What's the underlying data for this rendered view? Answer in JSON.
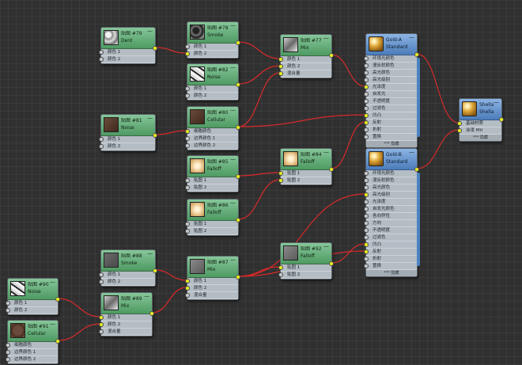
{
  "editor": {
    "accent": "#5aa870",
    "wire_color": "#d82a2a",
    "port_color": "#e8f020"
  },
  "nodes": [
    {
      "id": "n79",
      "kind": "map",
      "icon": "dent-texture-icon",
      "title": "贴图 #79",
      "subtitle": "Dent",
      "rows": [
        "颜色 1",
        "颜色 2"
      ],
      "connected": [
        false,
        false
      ],
      "out": true
    },
    {
      "id": "n78",
      "kind": "map",
      "icon": "smoke-texture-icon",
      "title": "贴图 #78",
      "subtitle": "Smoke",
      "rows": [
        "颜色 1",
        "颜色 2"
      ],
      "connected": [
        false,
        true
      ],
      "out": true
    },
    {
      "id": "n82",
      "kind": "map",
      "icon": "noise-texture-icon",
      "title": "贴图 #82",
      "subtitle": "Noise",
      "rows": [
        "颜色 1",
        "颜色 2"
      ],
      "connected": [
        false,
        false
      ],
      "out": true
    },
    {
      "id": "n81",
      "kind": "map",
      "icon": "noise-texture-icon",
      "title": "贴图 #81",
      "subtitle": "Noise",
      "rows": [
        "颜色 1",
        "颜色 2"
      ],
      "connected": [
        false,
        false
      ],
      "out": true
    },
    {
      "id": "n80",
      "kind": "map",
      "icon": "cellular-texture-icon",
      "title": "贴图 #80",
      "subtitle": "Cellular",
      "rows": [
        "细胞颜色",
        "边界颜色 1",
        "边界颜色 2"
      ],
      "connected": [
        true,
        false,
        false
      ],
      "out": true
    },
    {
      "id": "n77",
      "kind": "map",
      "icon": "mix-texture-icon",
      "title": "贴图 #77",
      "subtitle": "Mix",
      "rows": [
        "颜色 1",
        "颜色 2",
        "混合量"
      ],
      "connected": [
        true,
        true,
        true
      ],
      "out": true
    },
    {
      "id": "n85",
      "kind": "map",
      "icon": "falloff-texture-icon",
      "title": "贴图 #85",
      "subtitle": "Falloff",
      "rows": [
        "贴图 1",
        "贴图 2"
      ],
      "connected": [
        false,
        false
      ],
      "out": true
    },
    {
      "id": "n84",
      "kind": "map",
      "icon": "falloff-texture-icon",
      "title": "贴图 #84",
      "subtitle": "Falloff",
      "rows": [
        "贴图 1",
        "贴图 2"
      ],
      "connected": [
        true,
        true
      ],
      "out": true
    },
    {
      "id": "n86",
      "kind": "map",
      "icon": "falloff-texture-icon",
      "title": "贴图 #86",
      "subtitle": "Falloff",
      "rows": [
        "贴图 1",
        "贴图 2"
      ],
      "connected": [
        false,
        false
      ],
      "out": true
    },
    {
      "id": "n88",
      "kind": "map",
      "icon": "smoke-texture-icon",
      "title": "贴图 #88",
      "subtitle": "Smoke",
      "rows": [
        "颜色 1",
        "颜色 2"
      ],
      "connected": [
        false,
        false
      ],
      "out": true
    },
    {
      "id": "n87",
      "kind": "map",
      "icon": "mix-texture-icon",
      "title": "贴图 #87",
      "subtitle": "Mix",
      "rows": [
        "颜色 1",
        "颜色 2",
        "混合量"
      ],
      "connected": [
        true,
        true,
        false
      ],
      "out": true
    },
    {
      "id": "n92",
      "kind": "map",
      "icon": "falloff-texture-icon",
      "title": "贴图 #92",
      "subtitle": "Falloff",
      "rows": [
        "贴图 1",
        "贴图 2"
      ],
      "connected": [
        true,
        false
      ],
      "out": true
    },
    {
      "id": "n90",
      "kind": "map",
      "icon": "noise-texture-icon",
      "title": "贴图 #90",
      "subtitle": "Noise",
      "rows": [
        "颜色 1",
        "颜色 2"
      ],
      "connected": [
        false,
        false
      ],
      "out": true
    },
    {
      "id": "n89",
      "kind": "map",
      "icon": "mix-texture-icon",
      "title": "贴图 #89",
      "subtitle": "Mix",
      "rows": [
        "颜色 1",
        "颜色 2",
        "混合量"
      ],
      "connected": [
        true,
        true,
        false
      ],
      "out": true
    },
    {
      "id": "n91",
      "kind": "map",
      "icon": "cellular-texture-icon",
      "title": "贴图 #91",
      "subtitle": "Cellular",
      "rows": [
        "细胞颜色",
        "边界颜色 1",
        "边界颜色 2"
      ],
      "connected": [
        false,
        false,
        false
      ],
      "out": true
    },
    {
      "id": "goldA",
      "kind": "mtl",
      "icon": "gold-sphere-icon",
      "title": "Gold-A",
      "subtitle": "Standard",
      "rows": [
        "环境光颜色",
        "漫反射颜色",
        "高光颜色",
        "高光级别",
        "光泽度",
        "自发光",
        "不透明度",
        "过滤色",
        "凹凸",
        "反射",
        "折射",
        "置换"
      ],
      "connected": [
        false,
        false,
        false,
        false,
        true,
        false,
        false,
        false,
        true,
        true,
        false,
        false
      ],
      "out": true,
      "footer": "*** 隐藏"
    },
    {
      "id": "goldB",
      "kind": "mtl",
      "icon": "gold-sphere-icon",
      "title": "Gold-B",
      "subtitle": "Standard",
      "rows": [
        "环境光颜色",
        "漫反射颜色",
        "高光颜色",
        "高光级别",
        "光泽度",
        "自发光颜色",
        "各向异性",
        "方向",
        "不透明度",
        "过滤色",
        "凹凸",
        "反射",
        "折射",
        "置换"
      ],
      "connected": [
        false,
        false,
        false,
        true,
        false,
        false,
        false,
        false,
        false,
        false,
        true,
        true,
        false,
        false
      ],
      "out": true,
      "footer": "*** 隐藏"
    },
    {
      "id": "shellac",
      "kind": "mtl",
      "icon": "gold-sphere-icon",
      "title": "ShellacTest",
      "subtitle": "Shellac",
      "rows": [
        "基础材质",
        "涂漆 Mtl"
      ],
      "connected": [
        true,
        true
      ],
      "out": true,
      "footer": "*** 隐藏"
    }
  ]
}
